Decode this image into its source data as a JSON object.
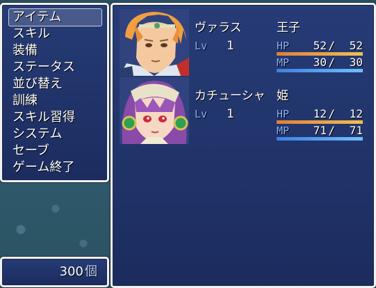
{
  "command_menu": {
    "items": [
      {
        "label": "アイテム",
        "selected": true
      },
      {
        "label": "スキル",
        "selected": false
      },
      {
        "label": "装備",
        "selected": false
      },
      {
        "label": "ステータス",
        "selected": false
      },
      {
        "label": "並び替え",
        "selected": false
      },
      {
        "label": "訓練",
        "selected": false
      },
      {
        "label": "スキル習得",
        "selected": false
      },
      {
        "label": "システム",
        "selected": false
      },
      {
        "label": "セーブ",
        "selected": false
      },
      {
        "label": "ゲーム終了",
        "selected": false
      }
    ]
  },
  "gold": {
    "amount": "300",
    "unit": "個"
  },
  "party": [
    {
      "name": "ヴァラス",
      "title": "王子",
      "level_label": "Lv",
      "level": "1",
      "hp_label": "HP",
      "hp": "52",
      "hp_max": "52",
      "hp_fraction": 1.0,
      "mp_label": "MP",
      "mp": "30",
      "mp_max": "30",
      "mp_fraction": 1.0,
      "face_icon": "prince-portrait-icon"
    },
    {
      "name": "カチューシャ",
      "title": "姫",
      "level_label": "Lv",
      "level": "1",
      "hp_label": "HP",
      "hp": "12",
      "hp_max": "12",
      "hp_fraction": 1.0,
      "mp_label": "MP",
      "mp": "71",
      "mp_max": "71",
      "mp_fraction": 1.0,
      "face_icon": "princess-portrait-icon"
    }
  ],
  "separator": "/",
  "colors": {
    "window_bg": "#263a78",
    "system_text": "#8cb0ff",
    "hp_gauge": "#f0c050",
    "mp_gauge": "#6fc0ff"
  }
}
